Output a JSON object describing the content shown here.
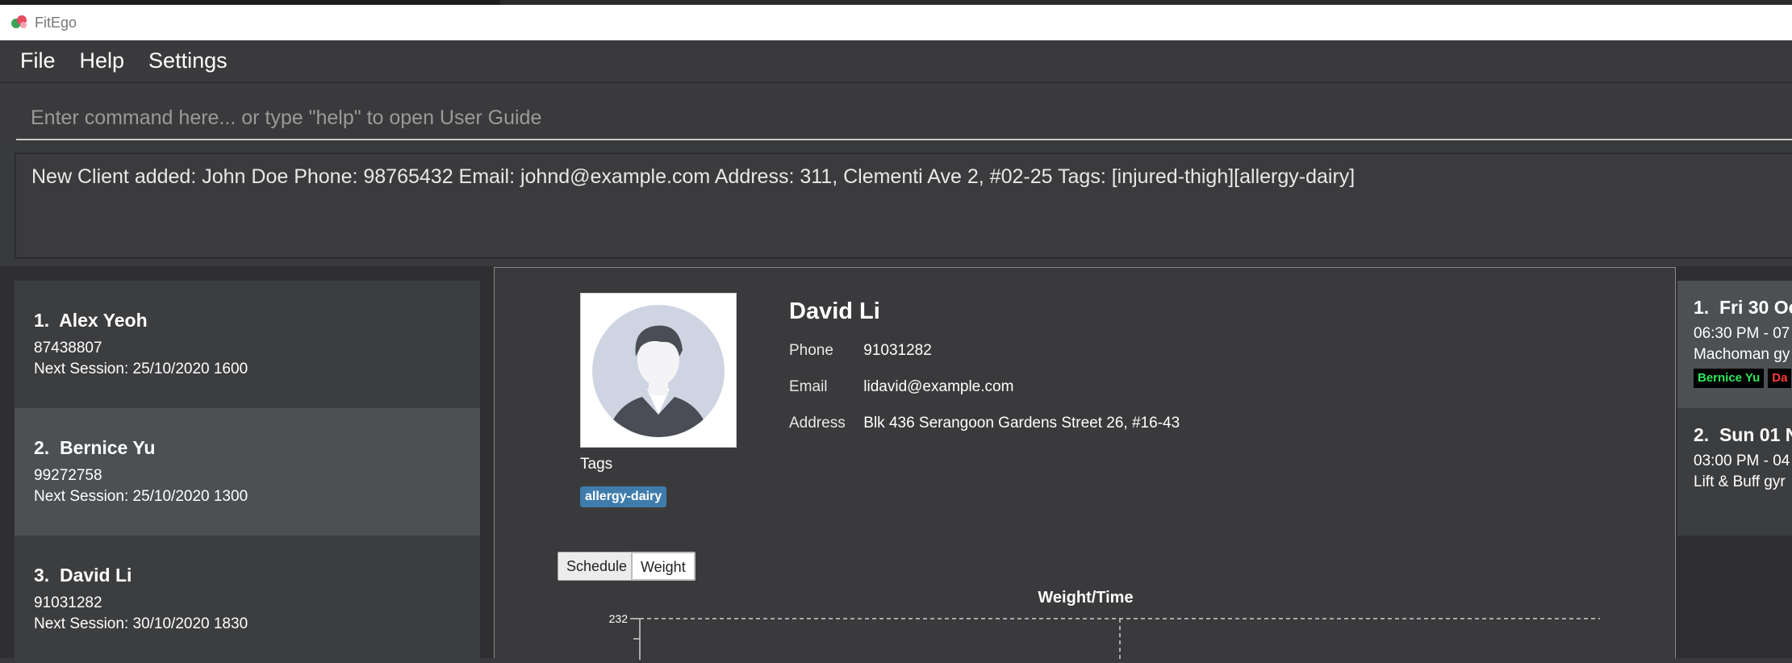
{
  "window": {
    "title": "FitEgo"
  },
  "menu": [
    "File",
    "Help",
    "Settings"
  ],
  "command": {
    "placeholder": "Enter command here... or type \"help\" to open User Guide",
    "value": ""
  },
  "result_text": "New Client added: John Doe Phone: 98765432 Email: johnd@example.com Address: 311, Clementi Ave 2, #02-25 Tags: [injured-thigh][allergy-dairy]",
  "clients": [
    {
      "index": "1.",
      "name": "Alex Yeoh",
      "phone": "87438807",
      "next_session": "Next Session: 25/10/2020 1600"
    },
    {
      "index": "2.",
      "name": "Bernice Yu",
      "phone": "99272758",
      "next_session": "Next Session: 25/10/2020 1300"
    },
    {
      "index": "3.",
      "name": "David Li",
      "phone": "91031282",
      "next_session": "Next Session: 30/10/2020 1830"
    }
  ],
  "detail": {
    "name": "David Li",
    "phone_label": "Phone",
    "phone": "91031282",
    "email_label": "Email",
    "email": "lidavid@example.com",
    "address_label": "Address",
    "address": "Blk 436 Serangoon Gardens Street 26, #16-43",
    "tags_label": "Tags",
    "tags": [
      "allergy-dairy"
    ],
    "tabs": [
      "Schedule",
      "Weight"
    ],
    "selected_tab": "Weight"
  },
  "chart_data": {
    "type": "line",
    "title": "Weight/Time",
    "y_ticks": [
      "232"
    ],
    "grid": true
  },
  "schedules": [
    {
      "index": "1.",
      "title": "Fri 30 Oc",
      "time": "06:30 PM - 07",
      "gym": "Machoman gy",
      "tags": [
        "Bernice Yu",
        "Da"
      ]
    },
    {
      "index": "2.",
      "title": "Sun 01 N",
      "time": "03:00 PM - 04",
      "gym": "Lift & Buff gyr",
      "tags": []
    }
  ],
  "colors": {
    "tag": "#3f7cab",
    "session_tag_green": "#2ee85a",
    "session_tag_red": "#ff3b3b"
  }
}
